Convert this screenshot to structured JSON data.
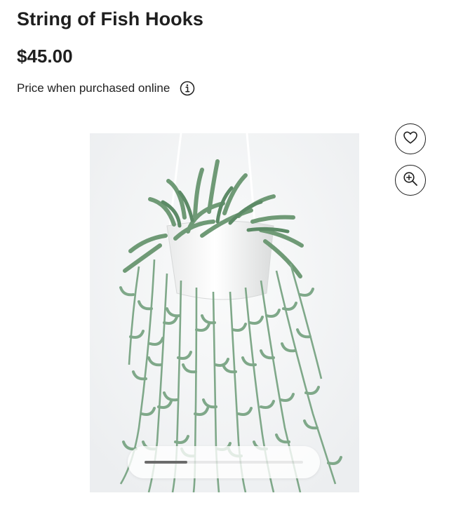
{
  "product": {
    "title": "String of Fish Hooks",
    "price": "$45.00",
    "price_note": "Price when purchased online"
  },
  "icons": {
    "info": "info-icon",
    "favorite": "heart-icon",
    "zoom": "zoom-in-icon"
  },
  "gallery": {
    "image_alt": "String of Fish Hooks hanging plant",
    "position_fraction": 0.27
  },
  "colors": {
    "text": "#1f1f1f",
    "leaf": "#6f9a76",
    "pot": "#ffffff",
    "background": "#f1f2f3"
  }
}
